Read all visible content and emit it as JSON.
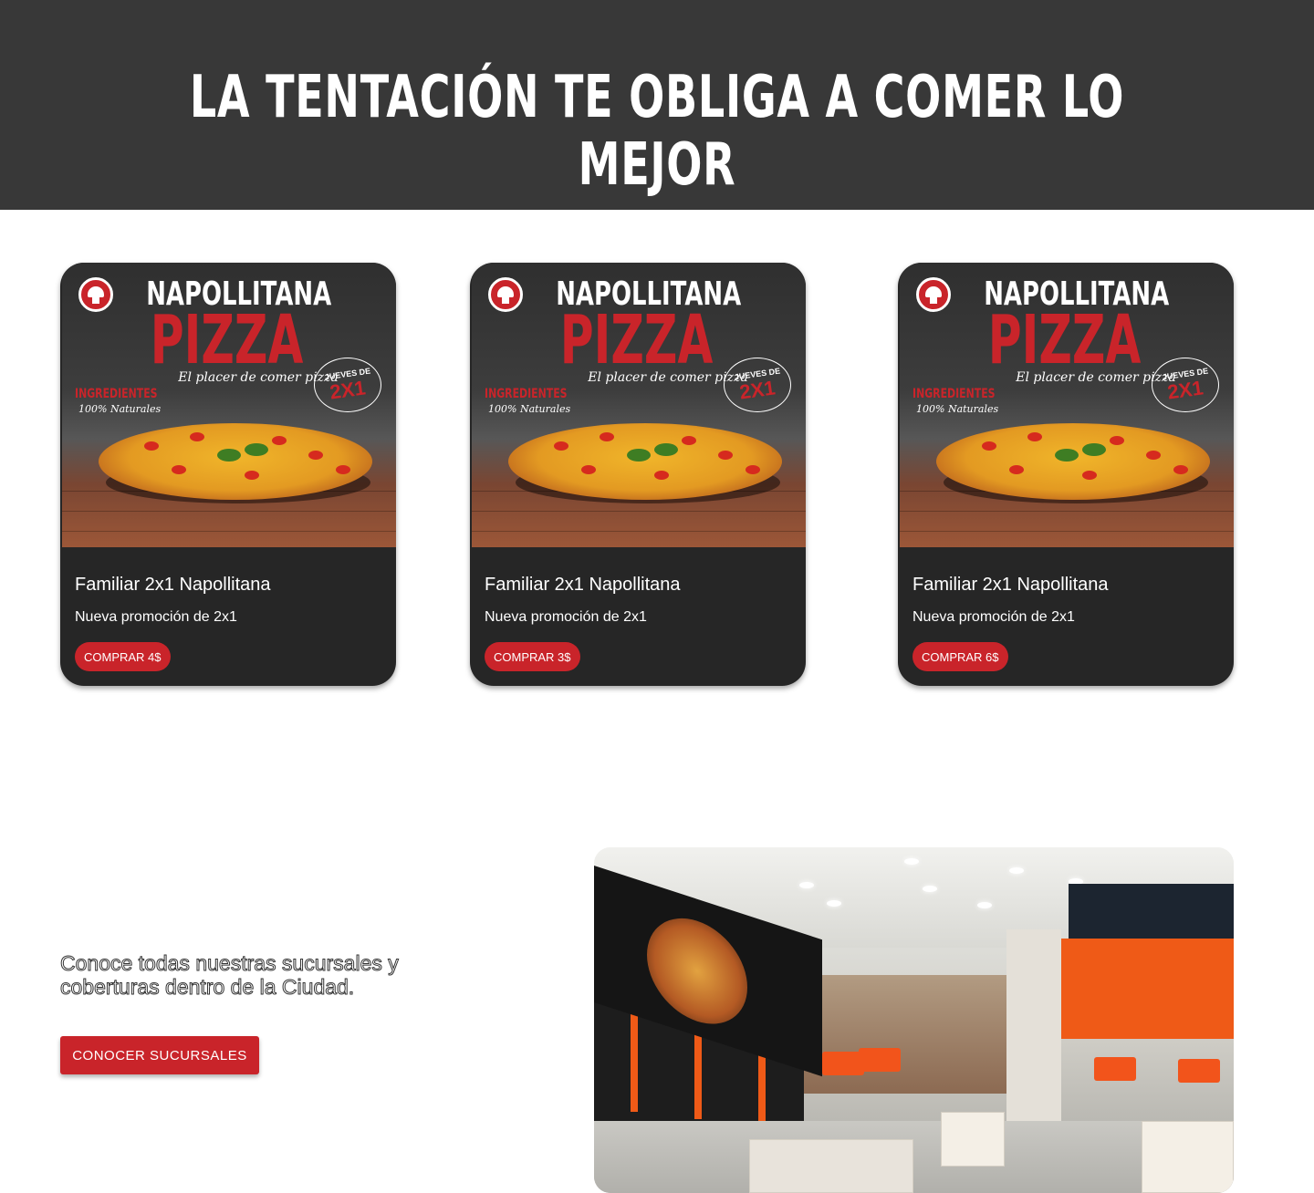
{
  "hero": {
    "title": "La tentación te obliga a comer lo mejor"
  },
  "poster": {
    "name": "NAPOLLITANA",
    "pizza": "PIZZA",
    "tagline": "El placer de comer pizza",
    "ingredients": "INGREDIENTES",
    "natural": "100% Naturales",
    "bubble_top": "JUEVES DE",
    "bubble_big": "2X1"
  },
  "products": [
    {
      "title": "Familiar 2x1 Napollitana",
      "description": "Nueva promoción de 2x1",
      "button": "COMPRAR 4$"
    },
    {
      "title": "Familiar 2x1 Napollitana",
      "description": "Nueva promoción de 2x1",
      "button": "COMPRAR 3$"
    },
    {
      "title": "Familiar 2x1 Napollitana",
      "description": "Nueva promoción de 2x1",
      "button": "COMPRAR 6$"
    }
  ],
  "branches": {
    "text": "Conoce todas nuestras sucursales y coberturas dentro de la Ciudad.",
    "button": "CONOCER SUCURSALES"
  },
  "colors": {
    "accent": "#c9242a",
    "hero_bg": "#383838",
    "card_bg": "#262626"
  },
  "icons": {
    "logo": "mushroom-logo-icon"
  }
}
